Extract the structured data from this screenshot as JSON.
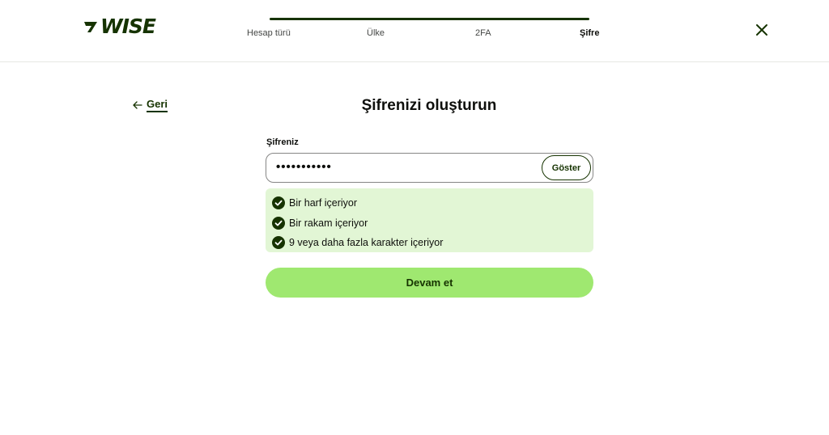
{
  "brand": {
    "name": "WISE",
    "icon": "wise-flag-icon",
    "color": "#163300"
  },
  "steps": [
    {
      "label": "Hesap türü",
      "active": false
    },
    {
      "label": "Ülke",
      "active": false
    },
    {
      "label": "2FA",
      "active": false
    },
    {
      "label": "Şifre",
      "active": true
    }
  ],
  "progress": 1.0,
  "header": {
    "close_icon": "close-icon"
  },
  "back": {
    "label": "Geri",
    "icon": "arrow-left-icon"
  },
  "page": {
    "title": "Şifrenizi oluşturun"
  },
  "password_field": {
    "label": "Şifreniz",
    "masked_value": "•••••••••••",
    "toggle_label": "Göster"
  },
  "requirements": [
    {
      "text": "Bir harf içeriyor",
      "met": true
    },
    {
      "text": "Bir rakam içeriyor",
      "met": true
    },
    {
      "text": "9 veya daha fazla karakter içeriyor",
      "met": true
    }
  ],
  "submit": {
    "label": "Devam et"
  },
  "colors": {
    "primary": "#9fe870",
    "forest": "#163300",
    "success_bg": "#e2f6d5"
  }
}
